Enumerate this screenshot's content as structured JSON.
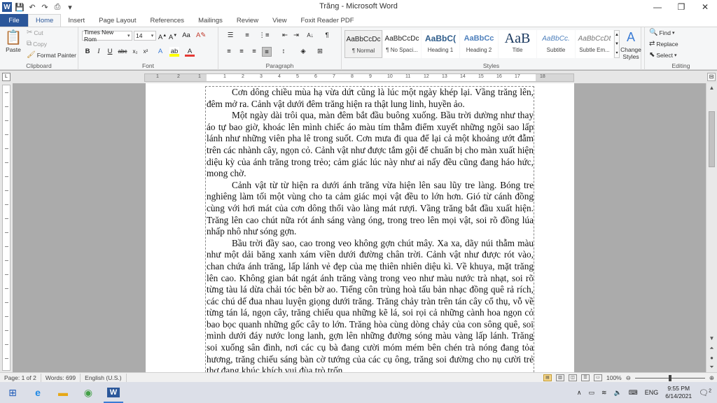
{
  "app": {
    "title": "Trăng  -  Microsoft Word"
  },
  "quick_access": {
    "app_icon": "W",
    "save_icon": "save-icon",
    "undo_icon": "undo-icon",
    "redo_icon": "redo-icon",
    "print_icon": "print-icon"
  },
  "window_controls": {
    "minimize": "—",
    "restore": "❐",
    "close": "✕"
  },
  "ribbon_tabs": [
    "File",
    "Home",
    "Insert",
    "Page Layout",
    "References",
    "Mailings",
    "Review",
    "View",
    "Foxit Reader PDF"
  ],
  "clipboard": {
    "paste": "Paste",
    "cut": "Cut",
    "copy": "Copy",
    "format_painter": "Format Painter",
    "label": "Clipboard"
  },
  "font": {
    "name": "Times New Rom",
    "size": "14",
    "label": "Font"
  },
  "paragraph": {
    "label": "Paragraph"
  },
  "styles": {
    "label": "Styles",
    "items": [
      {
        "sample": "AaBbCcDc",
        "name": "¶ Normal"
      },
      {
        "sample": "AaBbCcDc",
        "name": "¶ No Spaci..."
      },
      {
        "sample": "AaBbC(",
        "name": "Heading 1"
      },
      {
        "sample": "AaBbCc",
        "name": "Heading 2"
      },
      {
        "sample": "AaB",
        "name": "Title"
      },
      {
        "sample": "AaBbCc.",
        "name": "Subtitle"
      },
      {
        "sample": "AaBbCcDt",
        "name": "Subtle Em..."
      }
    ],
    "change_styles": "Change Styles"
  },
  "editing": {
    "label": "Editing",
    "find": "Find",
    "replace": "Replace",
    "select": "Select"
  },
  "ruler": {
    "numbers": [
      "1",
      "2",
      "1",
      "1",
      "2",
      "3",
      "4",
      "5",
      "6",
      "7",
      "8",
      "9",
      "10",
      "11",
      "12",
      "13",
      "14",
      "15",
      "16",
      "17",
      "18"
    ]
  },
  "document": {
    "paragraphs": [
      "Cơn dông chiều mùa hạ vừa dứt cũng là lúc một ngày khép lại. Vầng trăng lên, đêm mở ra. Cảnh vật dưới đêm trăng hiện ra thật lung linh, huyền ảo.",
      "Một ngày dài trôi qua, màn đêm bắt đầu buông xuống. Bầu trời dường như thay áo tự bao giờ, khoác lên mình chiếc áo màu tím thẫm điểm xuyết những ngôi sao lấp lánh như những viên pha lê trong suốt. Cơn mưa đi qua để lại cả một khoảng ướt đẫm trên các nhành cây, ngọn cỏ. Cảnh vật như được tắm gội để chuẩn bị cho màn xuất hiện diệu kỳ của ánh trăng trong trẻo; cảm giác lúc này như ai nấy đều cũng đang háo hức, mong chờ.",
      "Cảnh vật từ từ hiện ra dưới ánh trăng vừa hiện lên sau lũy tre làng. Bóng tre nghiêng làm tối một vùng cho ta cảm giác mọi vật đều to lớn hơn. Gió từ cánh đồng cùng với hơi mát của cơn dông thổi vào làng mát rượi. Vầng trăng bắt đầu xuất hiện.  Trăng lên cao chút nữa rót ánh sáng vàng óng, trong treo lên mọi vật, soi rõ đồng lúa nhấp nhô như sóng gợn.",
      "Bầu trời đầy sao, cao trong veo không gợn chút mây. Xa xa, dãy núi thẫm màu như một dải băng xanh xám viền dưới đường chân trời. Cảnh vật như được rót vào, chan chứa ánh trăng, lấp lánh vẻ đẹp của mẹ thiên nhiên diệu kì. Về khuya, mặt trăng lên cao. Không gian bát ngát ánh trăng vàng trong veo như màu nước trà nhạt, soi rõ từng tàu lá dừa chải tóc bên bờ ao. Tiếng côn trùng hoà tấu bản nhạc đồng quê rả rích, các chú dế đua nhau luyện giọng dưới trăng. Trăng chảy tràn trên tán cây cổ thụ, vỗ về từng tán lá, ngọn cây, trăng chiếu qua những kẽ lá, soi rọi cả những cành hoa ngọn cỏ bao bọc quanh những gốc cây to lớn. Trăng hòa cùng dòng chảy của con sông quê, soi mình dưới đáy nước long lanh, gợn lên những đường sóng màu vàng lấp lánh. Trăng soi xuống sân đình, nơi các cụ bà đang cười móm mém bên chén trà nóng đang tỏa hương, trăng chiếu sáng bàn cờ tướng của các cụ ông, trăng soi đường cho nụ cười trẻ thơ đang khúc khích vui đùa trò trốn"
    ]
  },
  "status_bar": {
    "page": "Page: 1 of 2",
    "words": "Words: 699",
    "language": "English (U.S.)",
    "zoom": "100%"
  },
  "taskbar": {
    "language": "ENG",
    "time": "9:55 PM",
    "date": "6/14/2021",
    "notifications": "2"
  }
}
